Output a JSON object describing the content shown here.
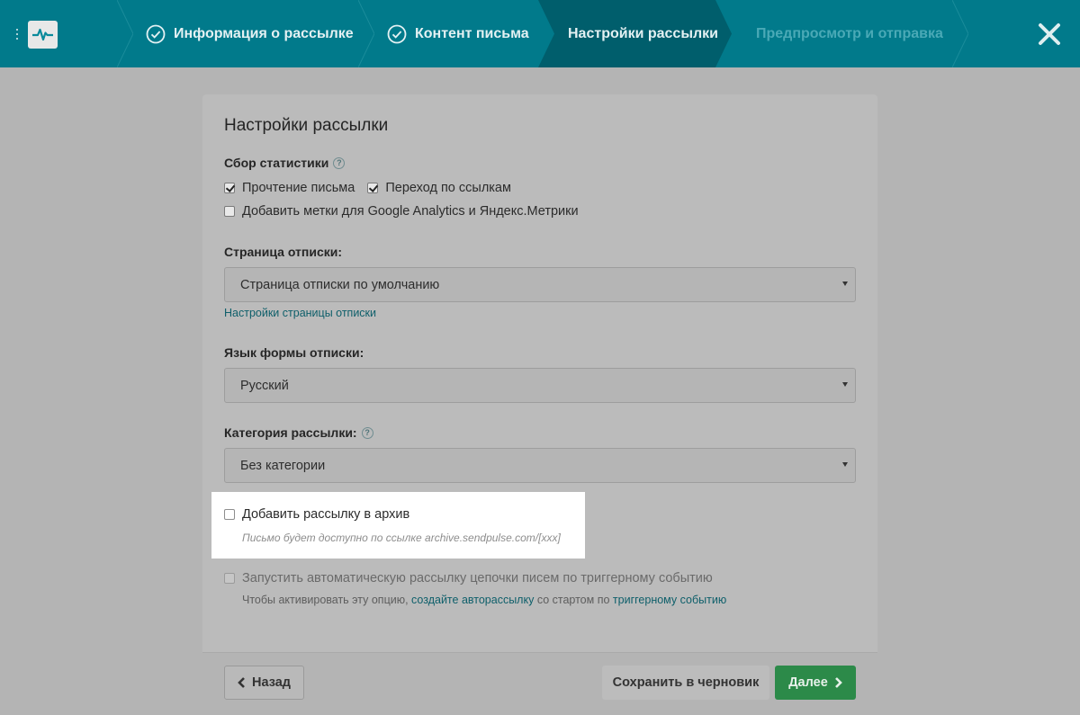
{
  "colors": {
    "header_bg": "#017a8b",
    "active_step_bg": "#005e6c",
    "accent_link": "#0e5f6a",
    "next_button": "#2c8a49"
  },
  "header": {
    "steps": [
      {
        "label": "Информация о рассылке",
        "state": "done"
      },
      {
        "label": "Контент письма",
        "state": "done"
      },
      {
        "label": "Настройки рассылки",
        "state": "active"
      },
      {
        "label": "Предпросмотр и отправка",
        "state": "disabled"
      }
    ],
    "close_icon": "close-icon"
  },
  "card": {
    "title": "Настройки рассылки",
    "stats": {
      "label": "Сбор статистики",
      "read_label": "Прочтение письма",
      "read_checked": true,
      "clicks_label": "Переход по ссылкам",
      "clicks_checked": true,
      "utm_label": "Добавить метки для Google Analytics и Яндекс.Метрики",
      "utm_checked": false
    },
    "unsubscribe_page": {
      "label": "Страница отписки:",
      "value": "Страница отписки по умолчанию",
      "settings_link": "Настройки страницы отписки"
    },
    "unsubscribe_lang": {
      "label": "Язык формы отписки:",
      "value": "Русский"
    },
    "category": {
      "label": "Категория рассылки:",
      "value": "Без категории"
    },
    "archive": {
      "label": "Добавить рассылку в архив",
      "checked": false,
      "hint": "Письмо будет доступно по ссылке archive.sendpulse.com/[xxx]"
    },
    "trigger": {
      "label": "Запустить автоматическую рассылку цепочки писем по триггерному событию",
      "note_prefix": "Чтобы активировать эту опцию, ",
      "note_link1": "создайте авторассылку",
      "note_middle": " со стартом по ",
      "note_link2": "триггерному событию"
    }
  },
  "footer": {
    "back_label": "Назад",
    "save_label": "Сохранить в черновик",
    "next_label": "Далее"
  }
}
